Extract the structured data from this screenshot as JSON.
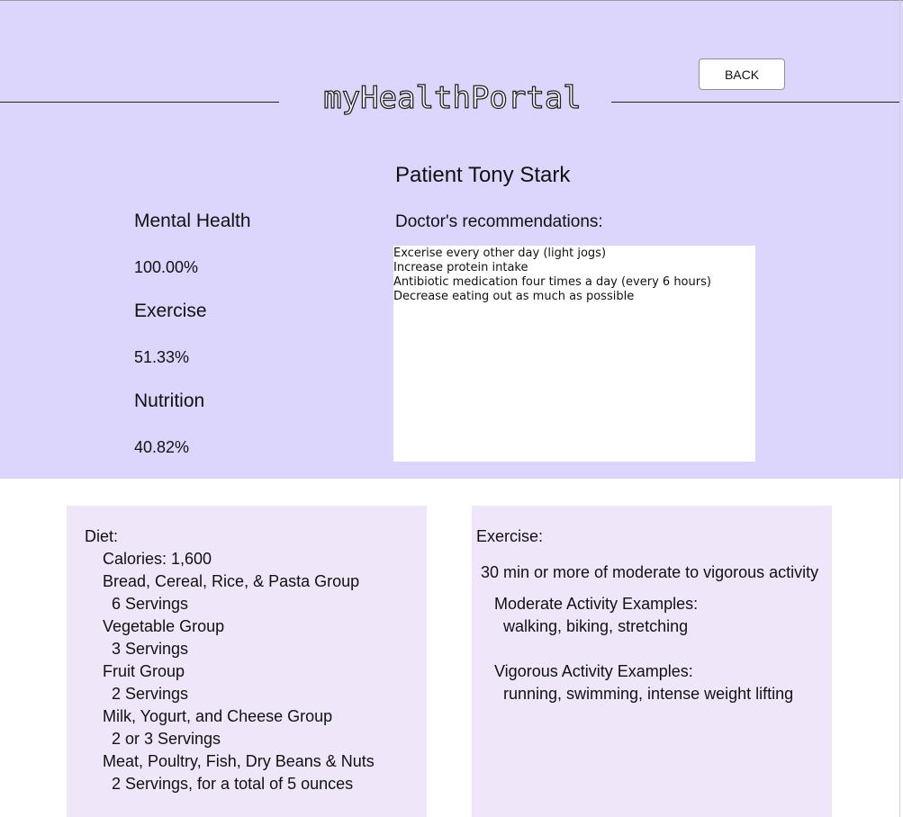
{
  "header": {
    "logo": "myHealthPortal",
    "back_label": "BACK"
  },
  "patient": {
    "title": "Patient Tony Stark"
  },
  "metrics": [
    {
      "label": "Mental Health",
      "value": "100.00%"
    },
    {
      "label": "Exercise",
      "value": "51.33%"
    },
    {
      "label": "Nutrition",
      "value": "40.82%"
    }
  ],
  "recommendations": {
    "label": "Doctor's recommendations:",
    "text": "Excerise every other day (light jogs)\nIncrease protein intake\nAntibiotic medication four times a day (every 6 hours)\nDecrease eating out as much as possible"
  },
  "diet": {
    "title": "Diet:",
    "calories": "Calories: 1,600",
    "groups": [
      {
        "name": "Bread, Cereal, Rice, & Pasta Group",
        "servings": "6 Servings"
      },
      {
        "name": "Vegetable Group",
        "servings": "3 Servings"
      },
      {
        "name": "Fruit Group",
        "servings": "2 Servings"
      },
      {
        "name": "Milk, Yogurt, and Cheese Group",
        "servings": "2 or 3 Servings"
      },
      {
        "name": "Meat, Poultry, Fish, Dry Beans & Nuts",
        "servings": "2 Servings, for a total of 5 ounces"
      }
    ]
  },
  "exercise": {
    "title": "Exercise:",
    "summary": "30 min or more of moderate to vigorous activity",
    "moderate_label": "Moderate Activity Examples:",
    "moderate_examples": "walking, biking, stretching",
    "vigorous_label": "Vigorous Activity Examples:",
    "vigorous_examples": "running, swimming, intense weight lifting"
  }
}
